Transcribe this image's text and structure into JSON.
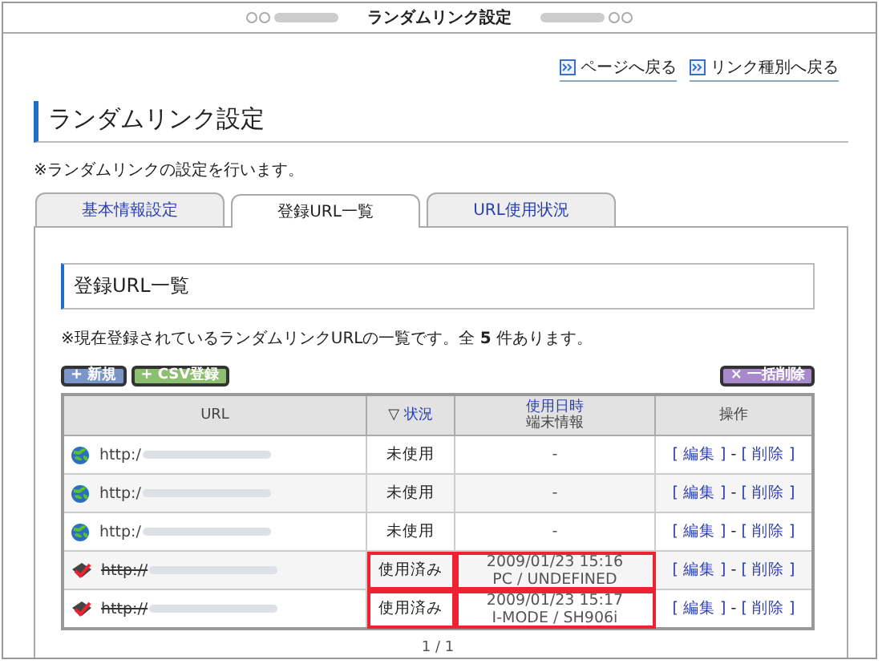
{
  "window": {
    "title": "ランダムリンク設定"
  },
  "nav_links": [
    "ページへ戻る",
    "リンク種別へ戻る"
  ],
  "page_title": "ランダムリンク設定",
  "page_note": "※ランダムリンクの設定を行います。",
  "tabs": [
    {
      "label": "基本情報設定",
      "selected": false
    },
    {
      "label": "登録URL一覧",
      "selected": true
    },
    {
      "label": "URL使用状況",
      "selected": false
    }
  ],
  "section": {
    "title": "登録URL一覧",
    "note": "※現在登録されているランダムリンクURLの一覧です。全 **5** 件あります。"
  },
  "buttons": {
    "new": "+ 新規",
    "csv": "+ CSV登録",
    "delete_all": "× 一括削除"
  },
  "table": {
    "columns": {
      "url": "URL",
      "sort": "▽",
      "status": "状況",
      "date": "使用日時",
      "device": "端末情報",
      "actions": "操作"
    },
    "rows": [
      {
        "url": "http:/",
        "used": false,
        "status": "未使用",
        "date": "-",
        "device": "",
        "highlighted": false,
        "edit": "[ 編集 ]",
        "sep": "-",
        "delete": "[ 削除 ]"
      },
      {
        "url": "http:/",
        "used": false,
        "status": "未使用",
        "date": "-",
        "device": "",
        "highlighted": false,
        "edit": "[ 編集 ]",
        "sep": "-",
        "delete": "[ 削除 ]"
      },
      {
        "url": "http:/",
        "used": false,
        "status": "未使用",
        "date": "-",
        "device": "",
        "highlighted": false,
        "edit": "[ 編集 ]",
        "sep": "-",
        "delete": "[ 削除 ]"
      },
      {
        "url": "http://",
        "used": true,
        "status": "使用済み",
        "date": "2009/01/23 15:16",
        "device": "PC / UNDEFINED",
        "highlighted": true,
        "edit": "[ 編集 ]",
        "sep": "-",
        "delete": "[ 削除 ]"
      },
      {
        "url": "http://",
        "used": true,
        "status": "使用済み",
        "date": "2009/01/23 15:17",
        "device": "I-MODE / SH906i",
        "highlighted": true,
        "edit": "[ 編集 ]",
        "sep": "-",
        "delete": "[ 削除 ]"
      }
    ]
  },
  "pager": "1 / 1"
}
